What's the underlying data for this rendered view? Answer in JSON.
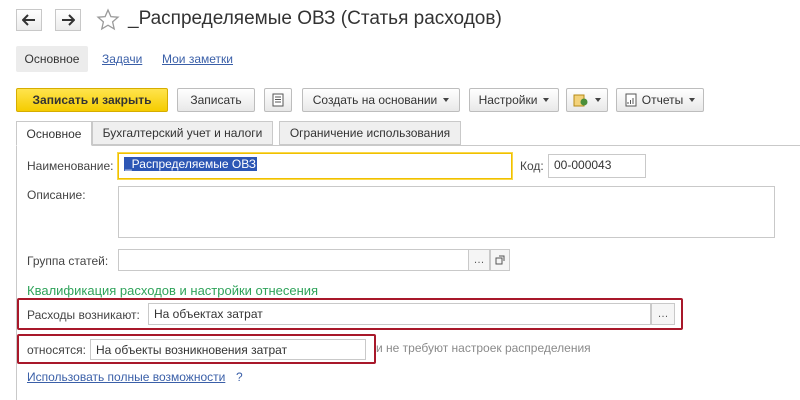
{
  "window": {
    "title": "_Распределяемые ОВЗ (Статья расходов)"
  },
  "sections": {
    "main": "Основное",
    "tasks": "Задачи",
    "notes": "Мои заметки"
  },
  "toolbar": {
    "save_close": "Записать и закрыть",
    "save": "Записать",
    "create_based": "Создать на основании",
    "settings": "Настройки",
    "reports": "Отчеты"
  },
  "tabs": [
    {
      "label": "Основное"
    },
    {
      "label": "Бухгалтерский учет и налоги"
    },
    {
      "label": "Ограничение использования"
    }
  ],
  "form": {
    "name_label": "Наименование:",
    "name_value": "_Распределяемые ОВЗ",
    "code_label": "Код:",
    "code_value": "00-000043",
    "description_label": "Описание:",
    "group_label": "Группа статей:",
    "group_value": "",
    "section_title": "Квалификация расходов и настройки отнесения",
    "expenses_arise_label": "Расходы возникают:",
    "expenses_arise_value": "На объектах затрат",
    "relate_label": "относятся:",
    "relate_value": "На объекты возникновения затрат",
    "hint": "и не требуют настроек распределения",
    "full_features_link": "Использовать полные возможности",
    "help": "?"
  },
  "colors": {
    "primary_button": "#f5cc00",
    "link": "#3a5fa8",
    "section_title": "#2fa35a",
    "highlight_frame": "#a8182a",
    "selection": "#2c56b5"
  }
}
